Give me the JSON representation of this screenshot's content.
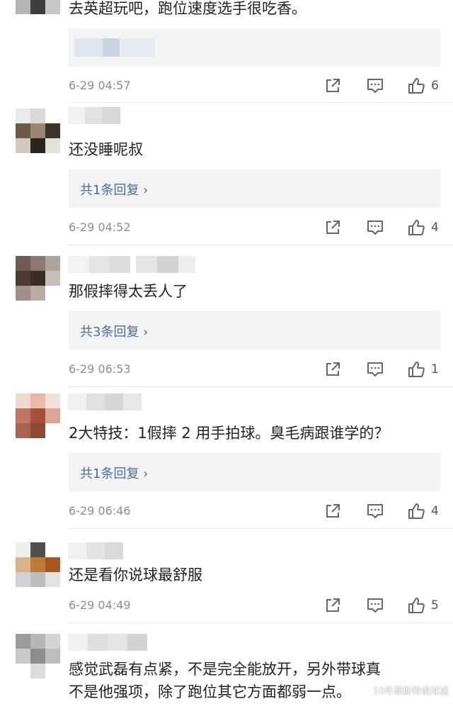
{
  "colors": {
    "reply_link": "#4a6f99",
    "timestamp": "#8c8c8c",
    "reply_bg": "#f3f3f3"
  },
  "comments": [
    {
      "text": "去英超玩吧，跑位速度选手很吃香。",
      "time": "6-29 04:57",
      "likes": "6",
      "reply": ""
    },
    {
      "text": "还没睡呢叔",
      "time": "6-29 04:52",
      "likes": "4",
      "reply": "共1条回复 ›"
    },
    {
      "text": "那假摔得太丢人了",
      "time": "6-29 06:53",
      "likes": "1",
      "reply": "共3条回复 ›"
    },
    {
      "text": "2大特技：1假摔 2 用手拍球。臭毛病跟谁学的？",
      "time": "6-29 06:46",
      "likes": "4",
      "reply": "共1条回复 ›"
    },
    {
      "text": "还是看你说球最舒服",
      "time": "6-29 04:49",
      "likes": "5",
      "reply": ""
    },
    {
      "text_lines": [
        "感觉武磊有点紧，不是完全能放开，另外带球真",
        "不是他强项，除了跑位其它方面都弱一点。"
      ]
    }
  ],
  "icons": {
    "share": "share-icon",
    "message": "comment-icon",
    "like": "thumbs-up-icon"
  },
  "watermark": "10年菲斯特说球迷"
}
